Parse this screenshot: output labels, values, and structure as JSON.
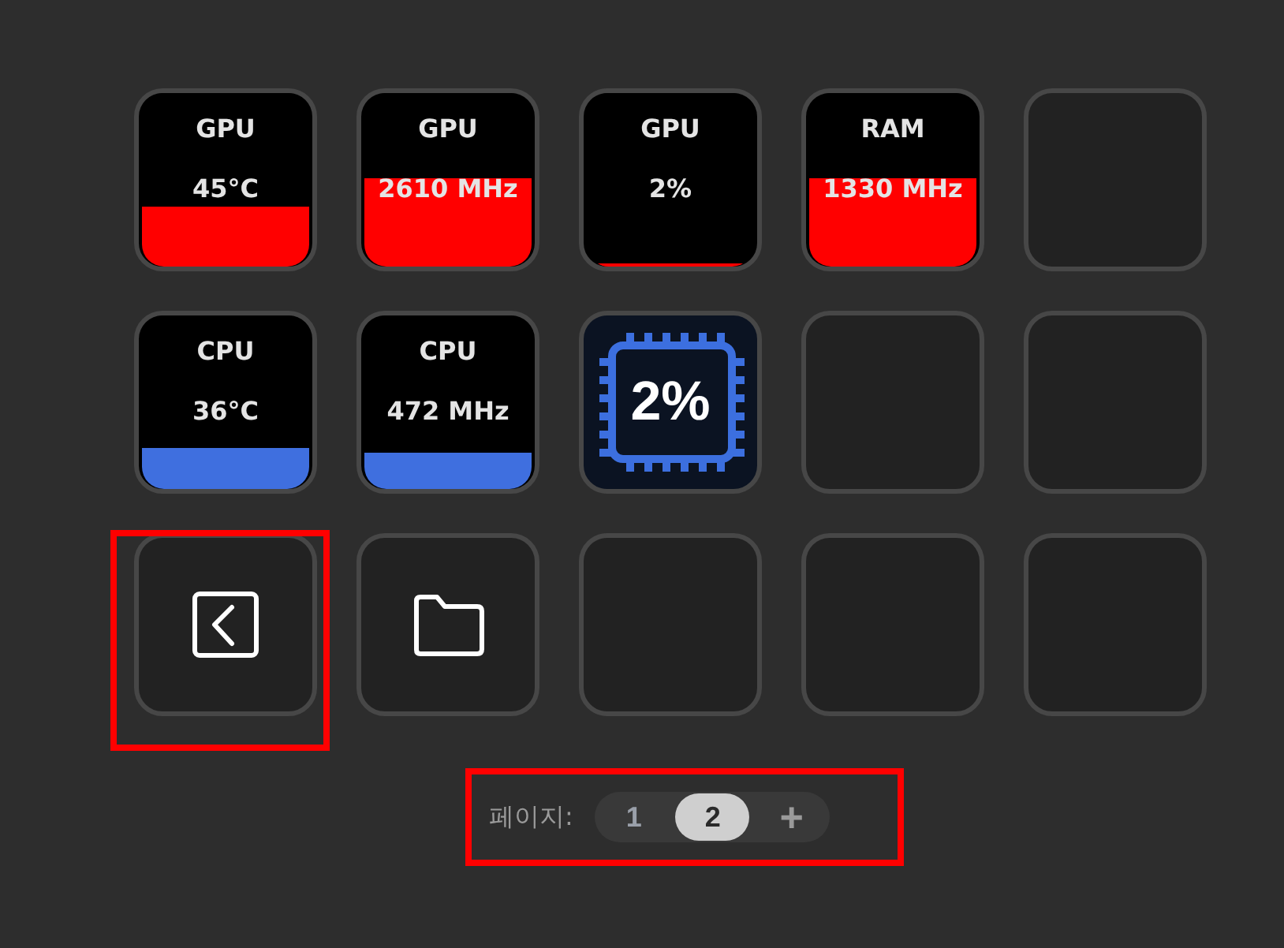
{
  "keys": [
    {
      "kind": "meter",
      "title": "GPU",
      "value": "45°C",
      "level": 0.35,
      "color": "#ff0000",
      "highlighted": false
    },
    {
      "kind": "meter",
      "title": "GPU",
      "value": "2610 MHz",
      "level": 0.51,
      "color": "#ff0000",
      "highlighted": false
    },
    {
      "kind": "meter",
      "title": "GPU",
      "value": "2%",
      "level": 0.02,
      "color": "#ff0000",
      "highlighted": false
    },
    {
      "kind": "meter",
      "title": "RAM",
      "value": "1330 MHz",
      "level": 0.51,
      "color": "#ff0000",
      "highlighted": false
    },
    {
      "kind": "empty",
      "highlighted": false
    },
    {
      "kind": "meter",
      "title": "CPU",
      "value": "36°C",
      "level": 0.24,
      "color": "#3f6fdf",
      "highlighted": false
    },
    {
      "kind": "meter",
      "title": "CPU",
      "value": "472 MHz",
      "level": 0.21,
      "color": "#3f6fdf",
      "highlighted": false
    },
    {
      "kind": "chip",
      "value": "2%",
      "highlighted": false
    },
    {
      "kind": "empty",
      "highlighted": false
    },
    {
      "kind": "empty",
      "highlighted": false
    },
    {
      "kind": "back",
      "highlighted": true
    },
    {
      "kind": "folder",
      "highlighted": false
    },
    {
      "kind": "empty",
      "highlighted": false
    },
    {
      "kind": "empty",
      "highlighted": false
    },
    {
      "kind": "empty",
      "highlighted": false
    }
  ],
  "pager": {
    "label": "페이지:",
    "pages": [
      {
        "label": "1",
        "selected": false
      },
      {
        "label": "2",
        "selected": true
      }
    ],
    "add": "+",
    "highlighted": true
  }
}
